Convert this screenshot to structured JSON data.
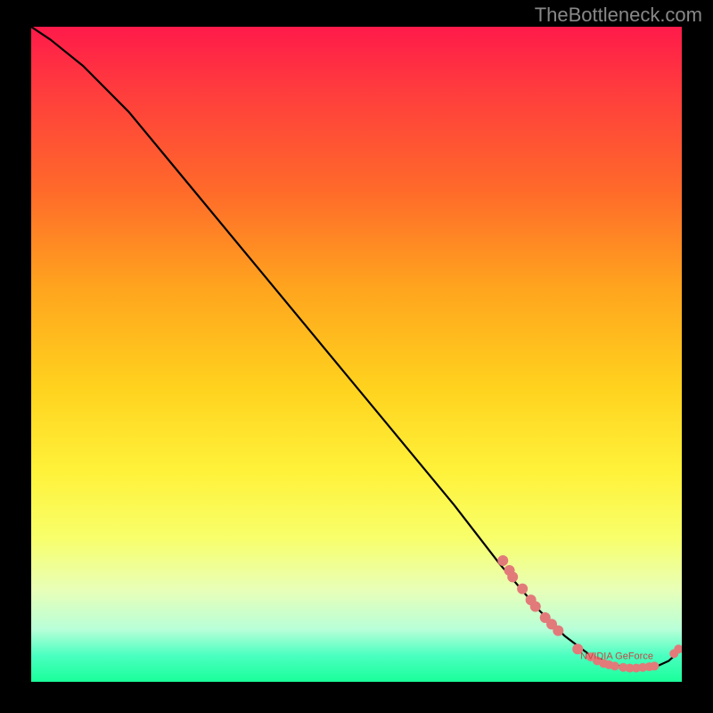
{
  "watermark": "TheBottleneck.com",
  "chart_data": {
    "type": "line",
    "title": "",
    "xlabel": "",
    "ylabel": "",
    "xlim": [
      0,
      100
    ],
    "ylim": [
      0,
      100
    ],
    "series": [
      {
        "name": "curve",
        "x": [
          0,
          3,
          8,
          15,
          25,
          35,
          45,
          55,
          65,
          72,
          78,
          82,
          86,
          90,
          93,
          96,
          98,
          100
        ],
        "y": [
          100,
          98,
          94,
          87,
          75,
          63,
          51,
          39,
          27,
          18,
          11,
          7,
          4,
          2.5,
          2,
          2.3,
          3.2,
          5
        ]
      }
    ],
    "markers": [
      {
        "x": 72.5,
        "y": 18.5,
        "r": 6
      },
      {
        "x": 73.5,
        "y": 17.0,
        "r": 6
      },
      {
        "x": 74.0,
        "y": 16.0,
        "r": 6
      },
      {
        "x": 75.5,
        "y": 14.2,
        "r": 6
      },
      {
        "x": 76.8,
        "y": 12.5,
        "r": 6
      },
      {
        "x": 77.5,
        "y": 11.5,
        "r": 6
      },
      {
        "x": 79.0,
        "y": 9.8,
        "r": 6
      },
      {
        "x": 80.0,
        "y": 8.8,
        "r": 6
      },
      {
        "x": 81.0,
        "y": 7.8,
        "r": 6
      },
      {
        "x": 84.0,
        "y": 5.0,
        "r": 6
      },
      {
        "x": 86.0,
        "y": 3.8,
        "r": 5
      },
      {
        "x": 87.0,
        "y": 3.2,
        "r": 5
      },
      {
        "x": 88.0,
        "y": 2.8,
        "r": 5
      },
      {
        "x": 88.8,
        "y": 2.6,
        "r": 5
      },
      {
        "x": 89.7,
        "y": 2.4,
        "r": 5
      },
      {
        "x": 91.0,
        "y": 2.2,
        "r": 5
      },
      {
        "x": 92.0,
        "y": 2.1,
        "r": 5
      },
      {
        "x": 93.0,
        "y": 2.1,
        "r": 5
      },
      {
        "x": 94.0,
        "y": 2.2,
        "r": 5
      },
      {
        "x": 95.0,
        "y": 2.3,
        "r": 5
      },
      {
        "x": 95.8,
        "y": 2.4,
        "r": 5
      },
      {
        "x": 98.8,
        "y": 4.3,
        "r": 5
      },
      {
        "x": 99.5,
        "y": 5.0,
        "r": 5
      }
    ],
    "marker_label": {
      "text": "NVIDIA GeForce",
      "x": 90,
      "y": 3.5
    },
    "colors": {
      "line": "#000000",
      "marker_fill": "#e27a7a",
      "marker_label": "#cc4444"
    }
  }
}
